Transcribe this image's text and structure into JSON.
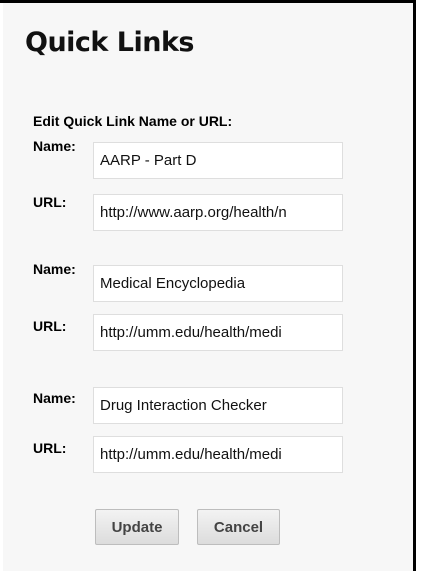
{
  "header": {
    "title": "Quick Links"
  },
  "form": {
    "instructions": "Edit Quick Link Name or URL:",
    "name_label": "Name:",
    "url_label": "URL:",
    "links": [
      {
        "name": "AARP - Part D",
        "url": "http://www.aarp.org/health/n"
      },
      {
        "name": "Medical Encyclopedia",
        "url": "http://umm.edu/health/medi"
      },
      {
        "name": "Drug Interaction Checker",
        "url": "http://umm.edu/health/medi"
      }
    ]
  },
  "buttons": {
    "update": "Update",
    "cancel": "Cancel"
  }
}
